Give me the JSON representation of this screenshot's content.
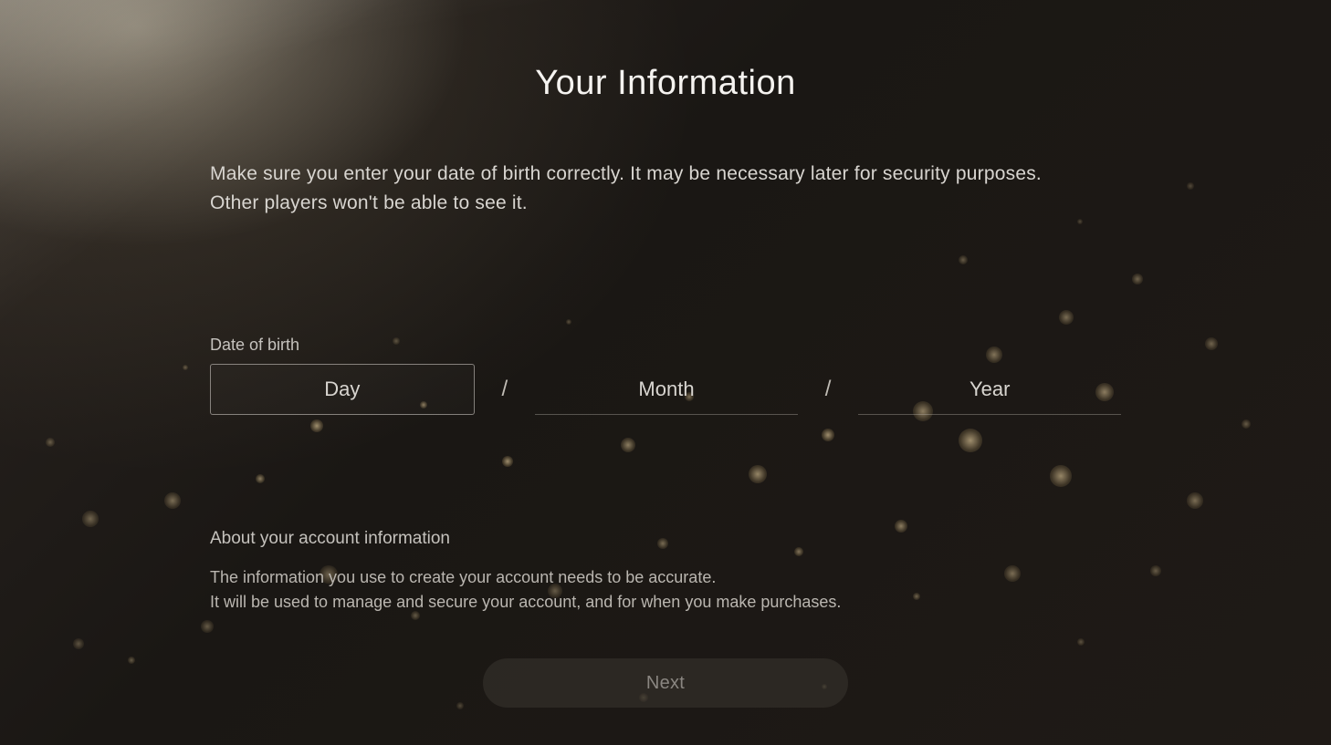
{
  "header": {
    "title": "Your Information"
  },
  "instruction": {
    "line1": "Make sure you enter your date of birth correctly. It may be necessary later for security purposes.",
    "line2": "Other players won't be able to see it."
  },
  "dob": {
    "label": "Date of birth",
    "day_placeholder": "Day",
    "month_placeholder": "Month",
    "year_placeholder": "Year",
    "separator": "/"
  },
  "info": {
    "heading": "About your account information",
    "line1": "The information you use to create your account needs to be accurate.",
    "line2": "It will be used to manage and secure your account, and for when you make purchases."
  },
  "actions": {
    "next_label": "Next"
  }
}
